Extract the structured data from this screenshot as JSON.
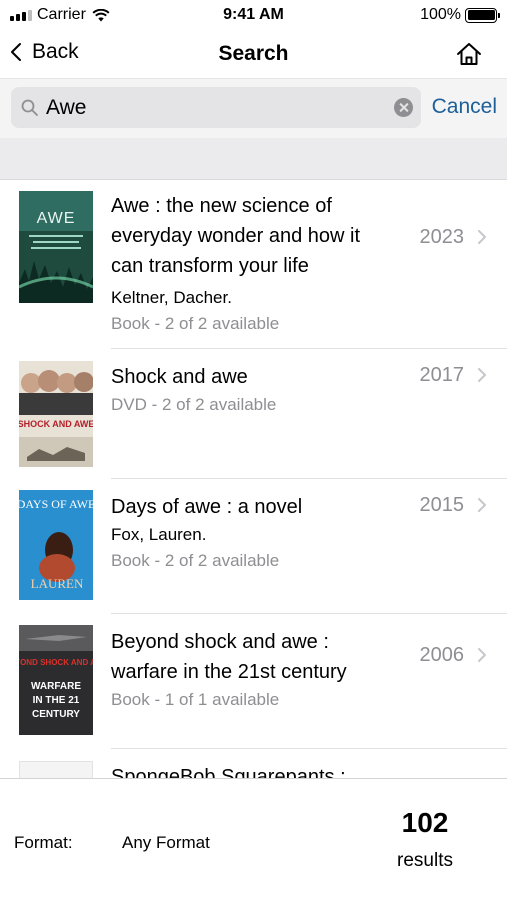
{
  "status_bar": {
    "carrier": "Carrier",
    "time": "9:41 AM",
    "battery": "100%"
  },
  "nav": {
    "back_label": "Back",
    "title": "Search"
  },
  "search": {
    "query": "Awe",
    "cancel_label": "Cancel"
  },
  "results": [
    {
      "title_lines": [
        "Awe : the new science of",
        "everyday wonder and how it",
        "can transform your life"
      ],
      "author": "Keltner, Dacher.",
      "availability": "Book - 2 of 2 available",
      "year": "2023",
      "cover_title": "AWE",
      "cover_color": "#1f4a3e"
    },
    {
      "title_lines": [
        "Shock and awe"
      ],
      "author": "",
      "availability": "DVD - 2 of 2 available",
      "year": "2017",
      "cover_title": "SHOCK AND AWE",
      "cover_color": "#e7e1d6"
    },
    {
      "title_lines": [
        "Days of awe : a novel"
      ],
      "author": "Fox, Lauren.",
      "availability": "Book - 2 of 2 available",
      "year": "2015",
      "cover_title": "DAYS OF AWE",
      "cover_color": "#2a8fcf"
    },
    {
      "title_lines": [
        "Beyond shock and awe :",
        "warfare in the 21st century"
      ],
      "author": "",
      "availability": "Book - 1 of 1 available",
      "year": "2006",
      "cover_title": "BEYOND SHOCK AND AWE",
      "cover_color": "#2c2c2e"
    },
    {
      "title_lines": [
        "SpongeBob Squarepants :"
      ],
      "author": "",
      "availability": "",
      "year": "",
      "cover_title": "",
      "cover_color": "#f4f4f4"
    }
  ],
  "footer": {
    "format_label": "Format:",
    "format_value": "Any Format",
    "result_count": "102",
    "result_count_label": "results"
  },
  "colors": {
    "accent": "#1d5f99",
    "secondary_text": "#8e8e93",
    "search_field": "#e4e4e6"
  }
}
